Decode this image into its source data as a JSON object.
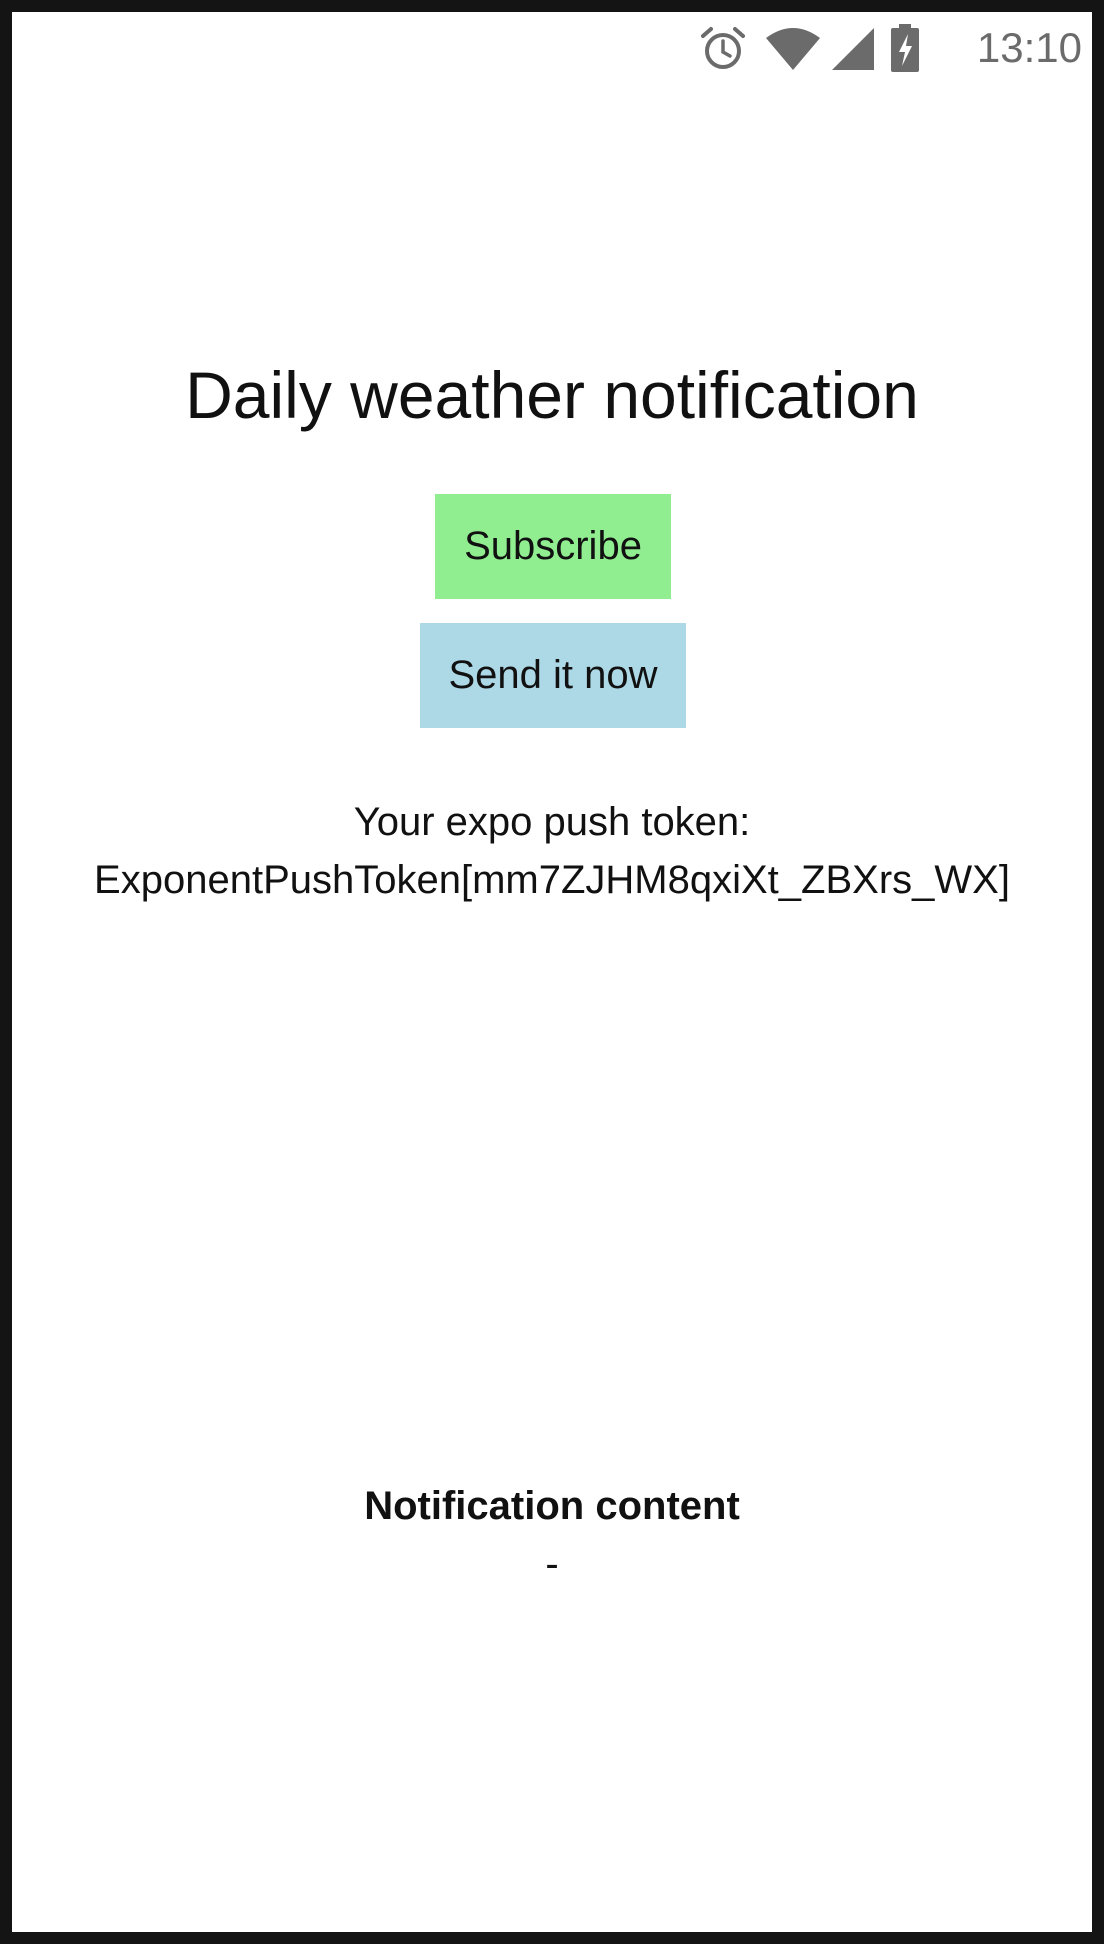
{
  "status_bar": {
    "time": "13:10",
    "icons": [
      "alarm-icon",
      "wifi-icon",
      "cell-signal-icon",
      "battery-charging-icon"
    ],
    "icon_color": "#6b6b6b"
  },
  "main": {
    "title": "Daily weather notification",
    "subscribe_button": {
      "label": "Subscribe",
      "color": "#90ee90"
    },
    "send_button": {
      "label": "Send it now",
      "color": "#add8e6"
    },
    "token_label": "Your expo push token:",
    "token_value": "ExponentPushToken[mm7ZJHM8qxiXt_ZBXrs_WX]",
    "notification": {
      "heading": "Notification content",
      "body": "-"
    }
  }
}
